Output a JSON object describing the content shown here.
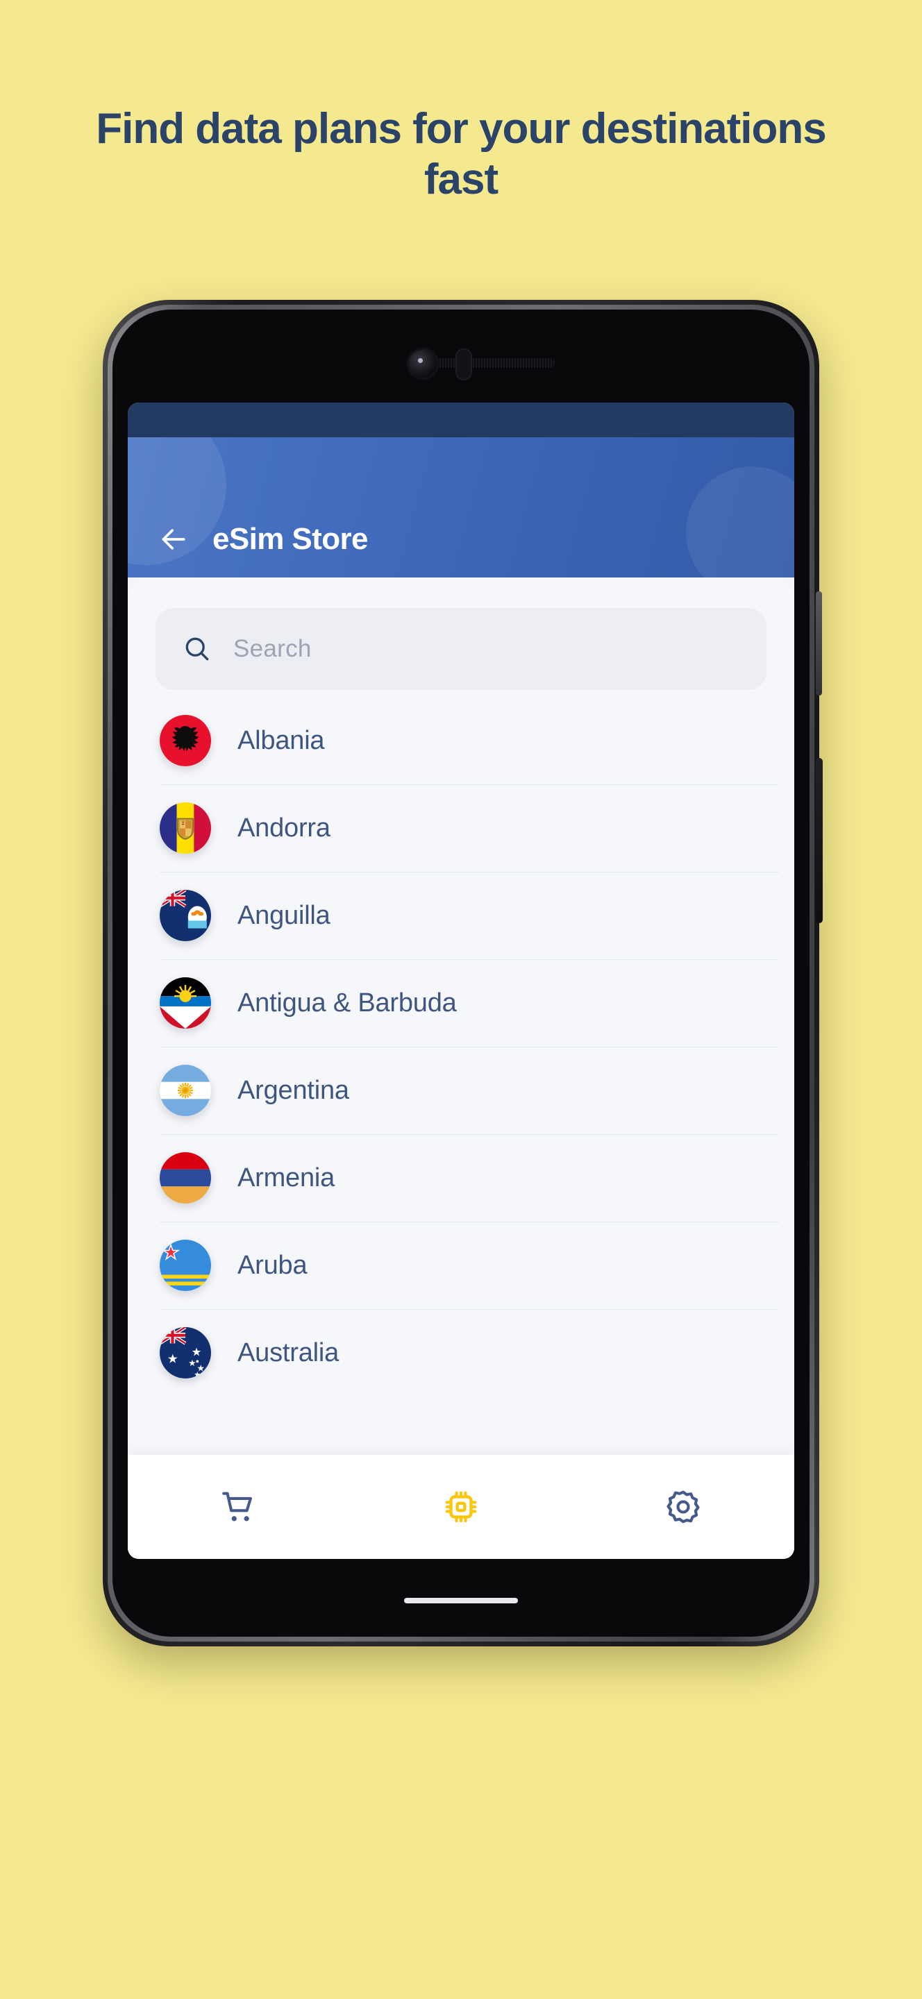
{
  "promo": {
    "headline": "Find data plans for your destinations fast",
    "background_color": "#f4e98f",
    "text_color": "#2b4368"
  },
  "app": {
    "header": {
      "title": "eSim Store",
      "back_icon": "arrow-left-icon",
      "gradient_from": "#4a76c4",
      "gradient_to": "#335aa8",
      "status_bar_color": "#233b62"
    },
    "search": {
      "placeholder": "Search",
      "value": "",
      "icon": "search-icon"
    },
    "countries": [
      {
        "name": "Albania",
        "flag": "albania-flag"
      },
      {
        "name": "Andorra",
        "flag": "andorra-flag"
      },
      {
        "name": "Anguilla",
        "flag": "anguilla-flag"
      },
      {
        "name": "Antigua & Barbuda",
        "flag": "antigua-and-barbuda-flag"
      },
      {
        "name": "Argentina",
        "flag": "argentina-flag"
      },
      {
        "name": "Armenia",
        "flag": "armenia-flag"
      },
      {
        "name": "Aruba",
        "flag": "aruba-flag"
      },
      {
        "name": "Australia",
        "flag": "australia-flag"
      }
    ],
    "bottom_nav": [
      {
        "id": "cart",
        "icon": "shopping-cart-icon",
        "active": false,
        "color": "#46598a"
      },
      {
        "id": "esim",
        "icon": "sim-chip-icon",
        "active": true,
        "color": "#fcc60a"
      },
      {
        "id": "settings",
        "icon": "gear-icon",
        "active": false,
        "color": "#46598a"
      }
    ]
  }
}
